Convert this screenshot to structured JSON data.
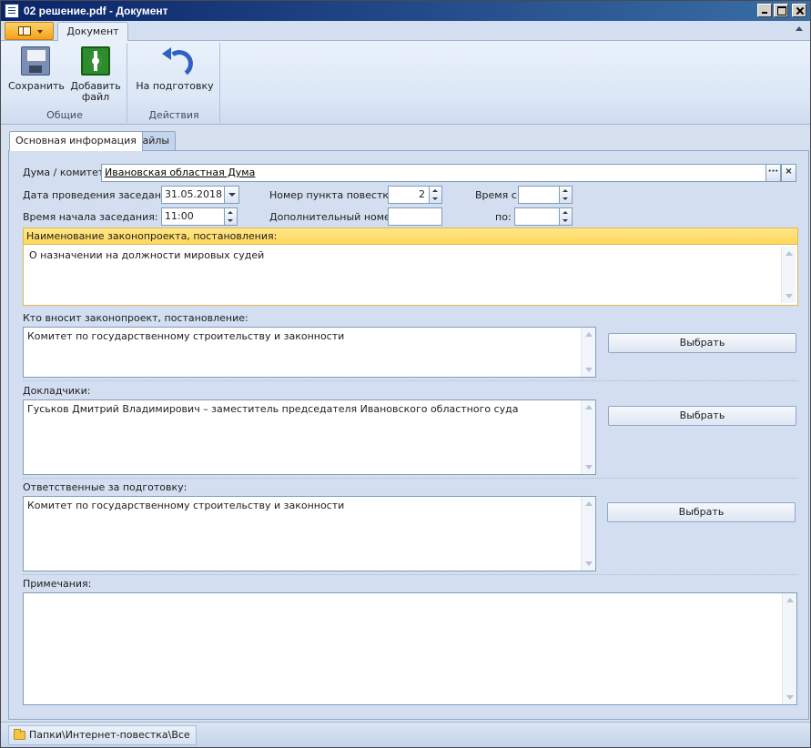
{
  "window": {
    "title": "02 решение.pdf - Документ"
  },
  "ribbon": {
    "tab_label": "Документ",
    "groups": {
      "general": {
        "label": "Общие",
        "save_label": "Сохранить",
        "add_file_label_1": "Добавить",
        "add_file_label_2": "файл"
      },
      "actions": {
        "label": "Действия",
        "to_prep_label": "На подготовку"
      }
    }
  },
  "tabs": {
    "main": "Основная информация",
    "files": "Файлы"
  },
  "form": {
    "duma_label": "Дума / комитет:",
    "duma_value": "Ивановская областная Дума",
    "meeting_date_label": "Дата проведения заседания:",
    "meeting_date_value": "31.05.2018",
    "meeting_time_label": "Время начала заседания:",
    "meeting_time_value": "11:00",
    "agenda_item_label": "Номер пункта повестки:",
    "agenda_item_value": "2",
    "extra_number_label": "Дополнительный номер:",
    "extra_number_value": "",
    "time_from_label": "Время с:",
    "time_from_value": "",
    "time_to_label": "по:",
    "time_to_value": "",
    "bill_name_label": "Наименование законопроекта, постановления:",
    "bill_name_value": "О назначении на должности мировых судей",
    "introducer_label": "Кто вносит законопроект, постановление:",
    "introducer_value": "Комитет по государственному строительству и законности",
    "speakers_label": "Докладчики:",
    "speakers_value": "Гуськов Дмитрий Владимирович – заместитель председателя Ивановского областного суда",
    "responsible_label": "Ответственные за подготовку:",
    "responsible_value": "Комитет по государственному строительству и законности",
    "notes_label": "Примечания:",
    "notes_value": "",
    "pick_label": "Выбрать"
  },
  "statusbar": {
    "path": "Папки\\Интернет-повестка\\Все"
  },
  "icons": [
    "document-icon",
    "app-menu-icon",
    "save-icon",
    "add-file-icon",
    "undo-icon",
    "folder-icon"
  ]
}
